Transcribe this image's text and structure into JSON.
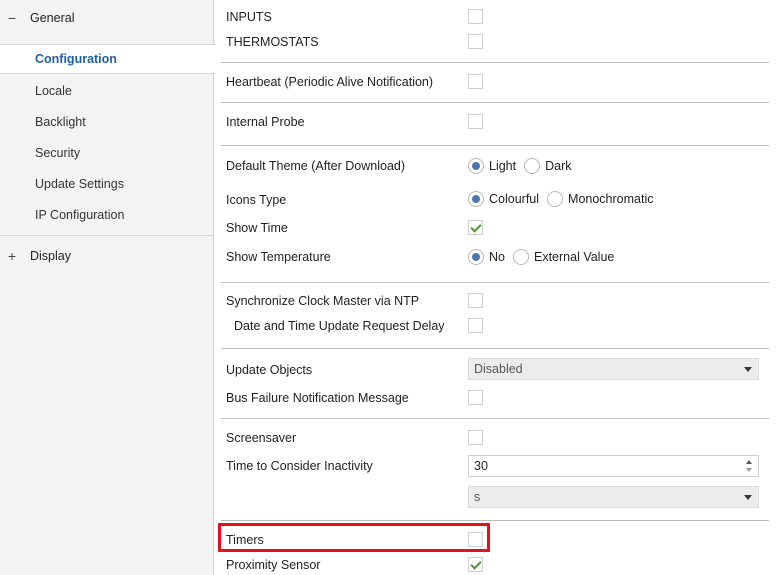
{
  "sidebar": {
    "general": {
      "toggle": "−",
      "label": "General"
    },
    "items": [
      {
        "label": "Configuration",
        "active": true
      },
      {
        "label": "Locale"
      },
      {
        "label": "Backlight"
      },
      {
        "label": "Security"
      },
      {
        "label": "Update Settings"
      },
      {
        "label": "IP Configuration"
      }
    ],
    "display": {
      "toggle": "+",
      "label": "Display"
    }
  },
  "main": {
    "inputs": {
      "label": "INPUTS",
      "checked": false
    },
    "thermostats": {
      "label": "THERMOSTATS",
      "checked": false
    },
    "heartbeat": {
      "label": "Heartbeat (Periodic Alive Notification)",
      "checked": false
    },
    "internal_probe": {
      "label": "Internal Probe",
      "checked": false
    },
    "default_theme": {
      "label": "Default Theme (After Download)",
      "options": [
        "Light",
        "Dark"
      ],
      "selected": "Light"
    },
    "icons_type": {
      "label": "Icons Type",
      "options": [
        "Colourful",
        "Monochromatic"
      ],
      "selected": "Colourful"
    },
    "show_time": {
      "label": "Show Time",
      "checked": true
    },
    "show_temperature": {
      "label": "Show Temperature",
      "options": [
        "No",
        "External Value"
      ],
      "selected": "No"
    },
    "sync_clock": {
      "label": "Synchronize Clock Master via NTP",
      "checked": false
    },
    "date_time_delay": {
      "label": "Date and Time Update Request Delay",
      "checked": false
    },
    "update_objects": {
      "label": "Update Objects",
      "value": "Disabled"
    },
    "bus_failure": {
      "label": "Bus Failure Notification Message",
      "checked": false
    },
    "screensaver": {
      "label": "Screensaver",
      "checked": false
    },
    "inactivity": {
      "label": "Time to Consider Inactivity",
      "value": "30",
      "unit": "s"
    },
    "timers": {
      "label": "Timers",
      "checked": false,
      "highlighted": true
    },
    "proximity": {
      "label": "Proximity Sensor",
      "checked": true
    }
  },
  "colors": {
    "accent": "#1f5fa8",
    "highlight_border": "#e0141e",
    "check": "#4a9a3a",
    "radio": "#4b76b0"
  }
}
